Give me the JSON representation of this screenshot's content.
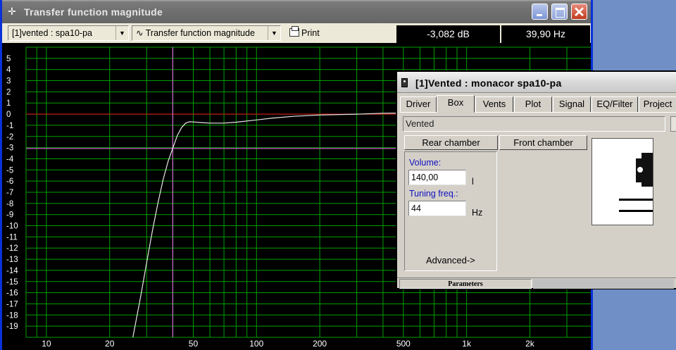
{
  "window": {
    "title": "Transfer function magnitude"
  },
  "toolbar": {
    "driver_selected": "[1]vented : spa10-pa",
    "plot_selected": "Transfer function magnitude",
    "print_label": "Print",
    "readout_level": "-3,082 dB",
    "readout_freq": "39,90 Hz"
  },
  "chart_data": {
    "type": "line",
    "x_scale": "log",
    "xlim": [
      8,
      3900
    ],
    "ylim": [
      -20,
      6
    ],
    "x_tick_labels": [
      "10",
      "20",
      "50",
      "100",
      "200",
      "500",
      "1k",
      "2k"
    ],
    "x_tick_values": [
      10,
      20,
      50,
      100,
      200,
      500,
      1000,
      2000
    ],
    "y_tick_labels": [
      "5",
      "4",
      "3",
      "2",
      "1",
      "0",
      "-1",
      "-2",
      "-3",
      "-4",
      "-5",
      "-6",
      "-7",
      "-8",
      "-9",
      "-10",
      "-11",
      "-12",
      "-13",
      "-14",
      "-15",
      "-16",
      "-17",
      "-18",
      "-19"
    ],
    "grid": true,
    "reference_line_db": 0,
    "cursor": {
      "freq_hz": 39.9,
      "level_db": -3.082
    },
    "series": [
      {
        "x": [
          25.8,
          28,
          30,
          32,
          34,
          36,
          38,
          39.9,
          42,
          44,
          46,
          48,
          50,
          55,
          60,
          70,
          80,
          100,
          120,
          150,
          200,
          300,
          400,
          500
        ],
        "y": [
          -20,
          -16.5,
          -13.3,
          -10.4,
          -7.9,
          -5.8,
          -4.2,
          -3.08,
          -1.9,
          -1.2,
          -0.8,
          -0.68,
          -0.7,
          -0.76,
          -0.8,
          -0.8,
          -0.72,
          -0.52,
          -0.35,
          -0.2,
          -0.08,
          0,
          0.08,
          0.1
        ]
      }
    ],
    "colors": {
      "grid": "#00a000",
      "curve": "#e8e8e8",
      "reference": "#d01818",
      "cursor": "#ff60ff",
      "axis_text": "#ffffff"
    }
  },
  "dialog": {
    "title": "[1]Vented : monacor spa10-pa",
    "tabs": [
      "Driver",
      "Box",
      "Vents",
      "Plot",
      "Signal",
      "EQ/Filter",
      "Project"
    ],
    "active_tab": "Box",
    "box_type": "Vented",
    "rear_chamber_label": "Rear chamber",
    "front_chamber_label": "Front chamber",
    "volume_label": "Volume:",
    "volume_value": "140,00",
    "volume_unit": "l",
    "tuning_label": "Tuning freq.:",
    "tuning_value": "44",
    "tuning_unit": "Hz",
    "advanced_label": "Advanced->",
    "status_label": "Parameters"
  }
}
